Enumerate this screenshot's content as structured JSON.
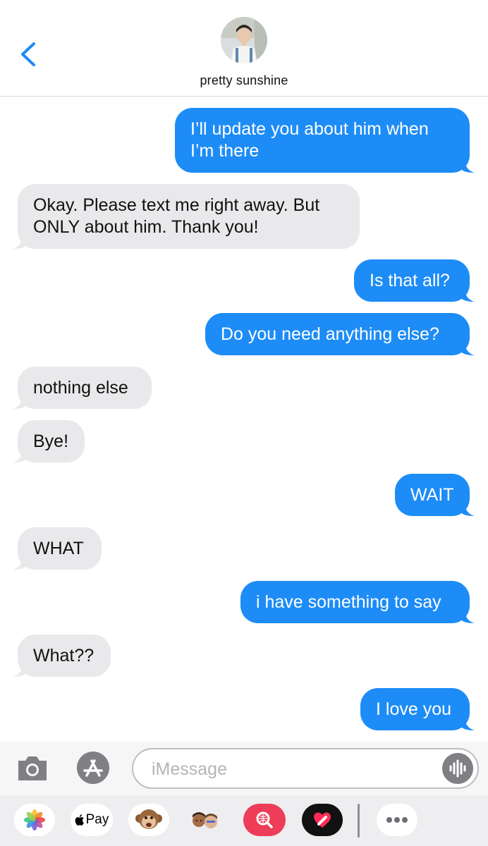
{
  "header": {
    "back_icon": "chevron-left-icon",
    "contact_name": "pretty sunshine",
    "avatar": "contact-avatar"
  },
  "colors": {
    "sent_bubble": "#1d8cf6",
    "received_bubble": "#e9e9eb",
    "accent": "#1d8cf6"
  },
  "messages": [
    {
      "from": "me",
      "text": "I’ll update you about him when\nI’m there"
    },
    {
      "from": "them",
      "text": "Okay. Please text me right away. But\nONLY about him. Thank you!"
    },
    {
      "from": "me",
      "text": "Is that all?"
    },
    {
      "from": "me",
      "text": "Do you need anything else?"
    },
    {
      "from": "them",
      "text": "nothing else"
    },
    {
      "from": "them",
      "text": "Bye!"
    },
    {
      "from": "me",
      "text": "WAIT"
    },
    {
      "from": "them",
      "text": "WHAT"
    },
    {
      "from": "me",
      "text": "i have something to say"
    },
    {
      "from": "them",
      "text": "What??"
    },
    {
      "from": "me",
      "text": "I love you"
    }
  ],
  "input": {
    "placeholder": "iMessage",
    "camera_icon": "camera-icon",
    "app_store_icon": "app-store-icon",
    "audio_icon": "audio-waveform-icon"
  },
  "app_drawer": {
    "items": [
      {
        "icon": "photos-icon"
      },
      {
        "icon": "apple-pay-icon",
        "label": "Pay"
      },
      {
        "icon": "animoji-monkey-icon"
      },
      {
        "icon": "memoji-icon"
      },
      {
        "icon": "image-search-icon"
      },
      {
        "icon": "digital-touch-icon"
      },
      {
        "icon": "more-icon"
      }
    ]
  }
}
